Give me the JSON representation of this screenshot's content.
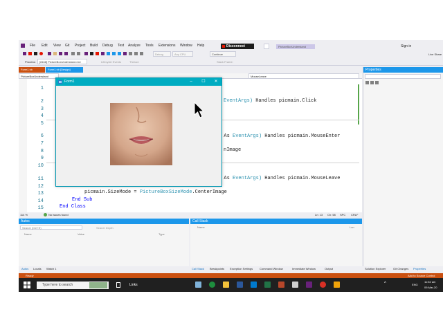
{
  "menubar": {
    "items": [
      "File",
      "Edit",
      "View",
      "Git",
      "Project",
      "Build",
      "Debug",
      "Test",
      "Analyze",
      "Tools",
      "Extensions",
      "Window",
      "Help"
    ],
    "debug_status": "Disconnect",
    "solution_name": "PictureBoxUnderstand",
    "signin": "Sign in",
    "liveshare": "Live Share"
  },
  "toolbar": {
    "config": "Debug",
    "platform": "Any CPU",
    "continue": "Continue"
  },
  "procbar": {
    "label": "Process:",
    "process": "[8168] PictureBoxUnderstand.exe",
    "lifecycle": "Lifecycle Events",
    "thread": "Thread:",
    "stackframe": "Stack Frame:"
  },
  "doc_tabs": [
    "Form1.vb",
    "Form1.vb [Design]"
  ],
  "nav": {
    "project": "PictureBoxUnderstand",
    "member": "MouseLeave"
  },
  "editor": {
    "line_numbers": [
      "1",
      "2",
      "3",
      "4",
      "5",
      "6",
      "7",
      "8",
      "9",
      "10",
      "11",
      "12",
      "13",
      "14",
      "15"
    ],
    "line2_tail_type": "EventArgs)",
    "line2_tail_rest": "Handles picmain.Click",
    "line7_as": "e As",
    "line7_type": "EventArgs)",
    "line7_rest": "Handles picmain.MouseEnter",
    "line9_tail": "nImage",
    "line12_as": "e As",
    "line12_type": "EventArgs)",
    "line12_rest": "Handles picmain.MouseLeave",
    "line13_lhs": "picmain.SizeMode = ",
    "line13_type": "PictureBoxSizeMode",
    "line13_rhs": ".CenterImage",
    "line14_end": "End",
    "line14_sub": "Sub",
    "line15_end": "End",
    "line15_class": "Class"
  },
  "editor_status": {
    "zoom": "114 %",
    "issues": "No issues found",
    "position": "Ln: 13",
    "column": "Ch: 58",
    "spc": "SPC",
    "crlf": "CRLF"
  },
  "form1": {
    "title": "Form1",
    "minimize": "–",
    "maximize": "☐",
    "close": "✕"
  },
  "properties": {
    "title": "Properties"
  },
  "autos": {
    "title": "Autos",
    "search_placeholder": "Search (Ctrl+E)",
    "search_depth": "Search Depth:",
    "columns": [
      "Name",
      "Value",
      "Type"
    ],
    "tabs": [
      "Autos",
      "Locals",
      "Watch 1"
    ]
  },
  "callstack": {
    "title": "Call Stack",
    "columns": [
      "Name",
      "Lan"
    ],
    "tabs": [
      "Call Stack",
      "Breakpoints",
      "Exception Settings",
      "Command Window",
      "Immediate Window",
      "Output"
    ]
  },
  "props_tabs": [
    "Solution Explorer",
    "Git Changes",
    "Properties"
  ],
  "statusbar": {
    "ready": "Ready",
    "source_control": "Add to Source Control"
  },
  "taskbar": {
    "search_placeholder": "Type here to search",
    "links": "Links",
    "lang": "ENG",
    "time": "11:52 am",
    "date": "09-Mar-20"
  },
  "colors": {
    "accent": "#1c97ea",
    "status_debug": "#ca5010",
    "form_title": "#00acc1",
    "vs_purple": "#68217a"
  }
}
